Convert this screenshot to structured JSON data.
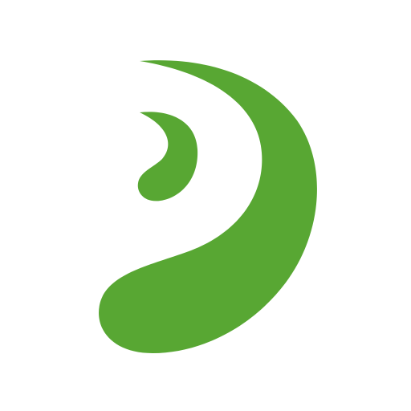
{
  "logo": {
    "name": "green-swirl-logo",
    "colors": {
      "brand": "#58a733",
      "background": "#ffffff"
    }
  }
}
